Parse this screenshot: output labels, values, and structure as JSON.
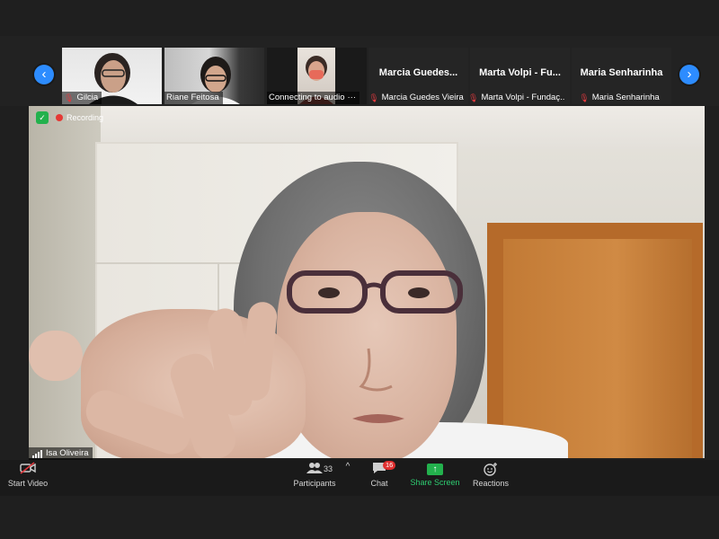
{
  "gallery": {
    "prev_icon": "chevron-left-icon",
    "next_icon": "chevron-right-icon",
    "tiles": [
      {
        "name": "Gilcia",
        "muted": true,
        "kind": "video"
      },
      {
        "name": "Riane Feitosa",
        "muted": false,
        "kind": "video"
      },
      {
        "name": "Connecting to audio",
        "muted": false,
        "kind": "video"
      },
      {
        "title": "Marcia  Guedes...",
        "name": "Marcia Guedes Vieira",
        "muted": true,
        "kind": "text"
      },
      {
        "title": "Marta Volpi - Fu...",
        "name": "Marta Volpi - Fundaç...",
        "muted": true,
        "kind": "text"
      },
      {
        "title": "Maria Senharinha",
        "name": "Maria Senharinha",
        "muted": true,
        "kind": "text"
      }
    ]
  },
  "main_video": {
    "speaker_name": "Isa Oliveira",
    "recording_label": "Recording"
  },
  "toolbar": {
    "start_video": "Start Video",
    "participants": "Participants",
    "participants_count": "33",
    "chat": "Chat",
    "chat_badge": "16",
    "share_screen": "Share Screen",
    "reactions": "Reactions"
  },
  "colors": {
    "accent": "#2d8cff",
    "share_green": "#23b14d",
    "recording_red": "#e53935",
    "mute_red": "#e0393e"
  }
}
